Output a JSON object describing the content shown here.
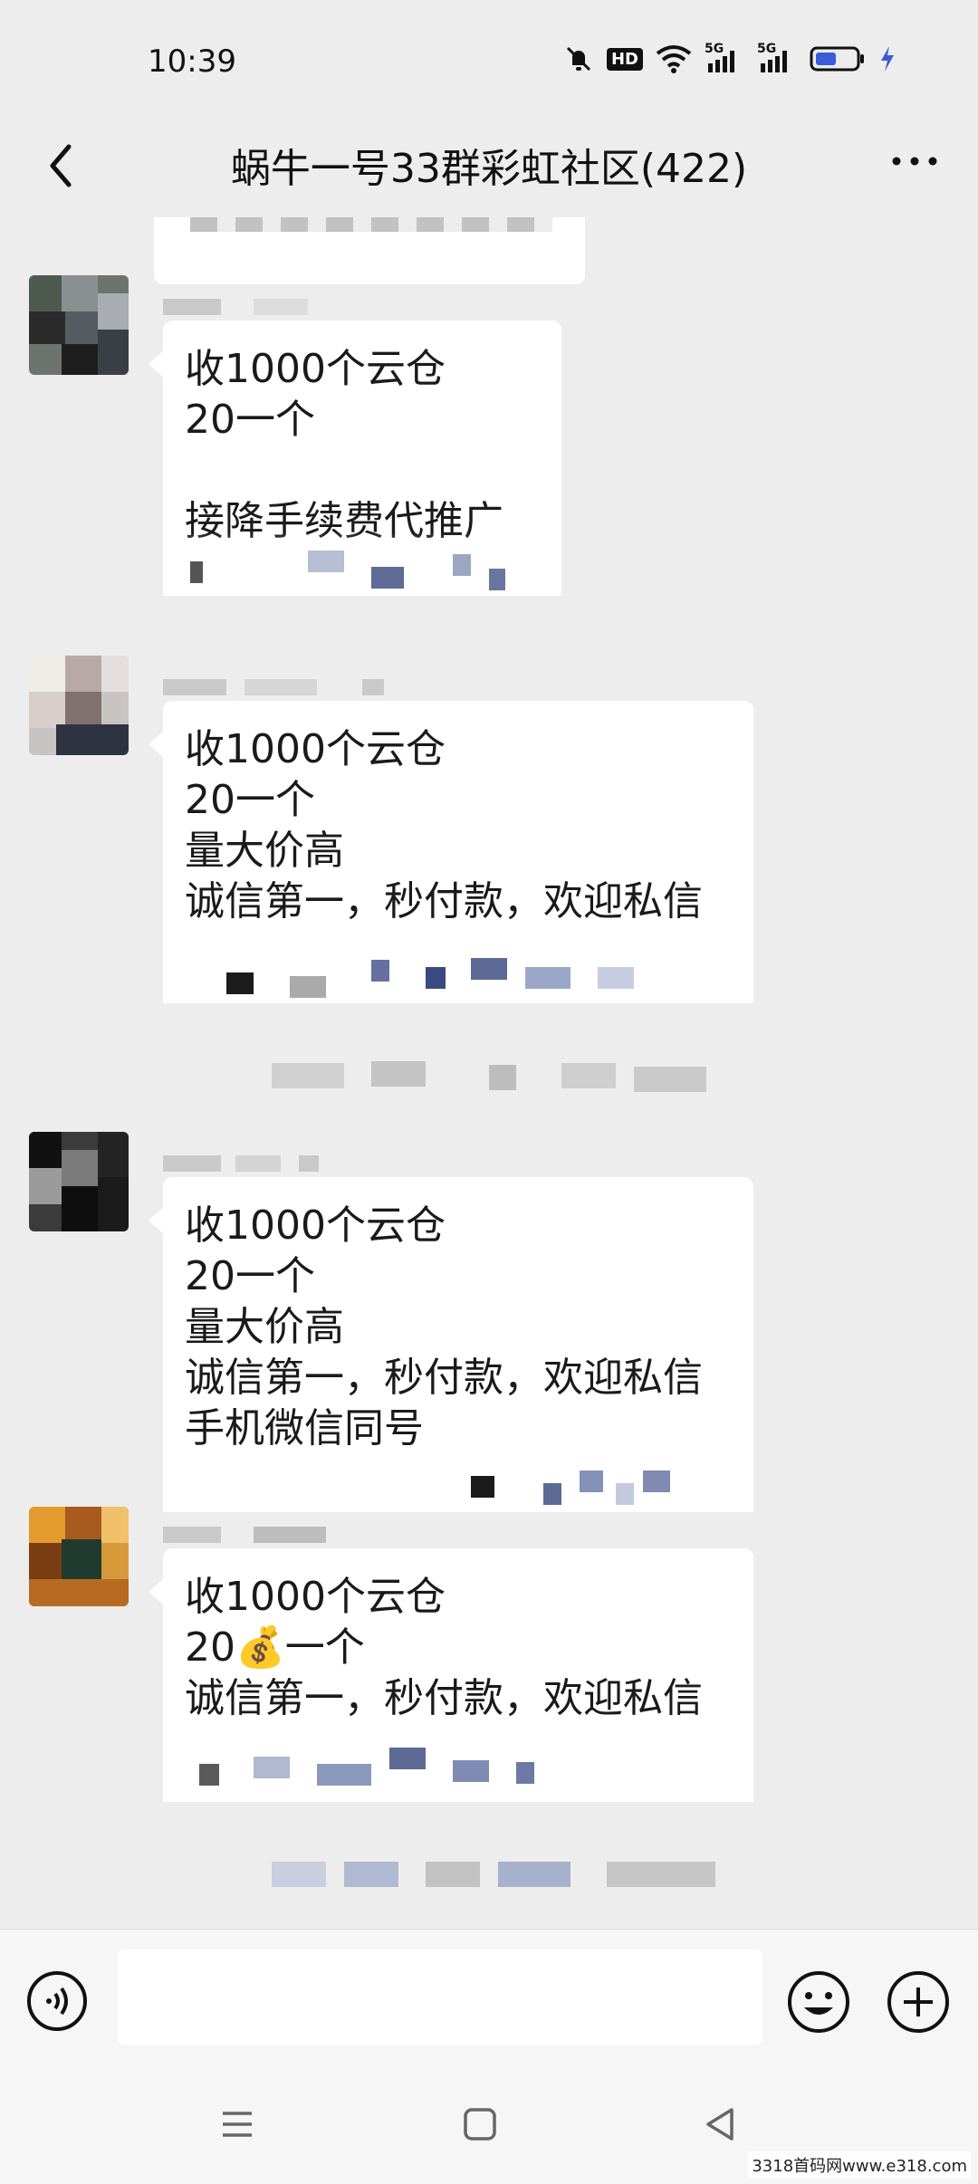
{
  "status_bar": {
    "time": "10:39",
    "icons": [
      "mute-bell-icon",
      "hd-icon",
      "wifi-icon",
      "5g-signal-icon",
      "5g-signal-icon",
      "battery-icon",
      "charging-icon"
    ],
    "hd_label": "HD",
    "net1": "5G",
    "net2": "5G"
  },
  "header": {
    "title": "蜗牛一号33群彩虹社区(422)",
    "back_icon": "chevron-left-icon",
    "more_icon": "more-dots-icon"
  },
  "messages": [
    {
      "lines": [
        "收1000个云仓",
        "20一个",
        "",
        "接降手续费代推广"
      ]
    },
    {
      "lines": [
        "收1000个云仓",
        "20一个",
        "量大价高",
        "诚信第一，秒付款，欢迎私信"
      ]
    },
    {
      "lines": [
        "收1000个云仓",
        "20一个",
        "量大价高",
        "诚信第一，秒付款，欢迎私信",
        "手机微信同号"
      ]
    },
    {
      "lines": [
        "收1000个云仓",
        "20💰一个",
        "诚信第一，秒付款，欢迎私信"
      ]
    }
  ],
  "input_bar": {
    "voice_icon": "voice-icon",
    "emoji_icon": "emoji-icon",
    "plus_icon": "plus-circle-icon"
  },
  "nav_bar": {
    "icons": [
      "menu-icon",
      "home-square-icon",
      "back-triangle-icon"
    ]
  },
  "watermark": "3318首码网www.e318.com",
  "colors": {
    "background": "#ededed",
    "bubble": "#ffffff",
    "accent_battery": "#3b5bdb"
  }
}
